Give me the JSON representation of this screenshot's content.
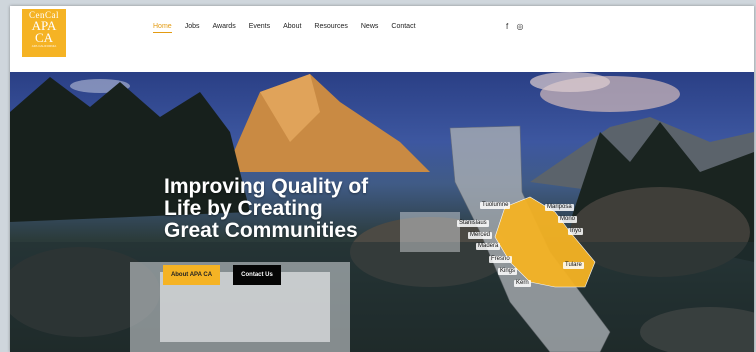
{
  "logo": {
    "line1": "CenCal",
    "line2": "APA",
    "line3": "CA",
    "tagline": "APA CALIFORNIA"
  },
  "nav": {
    "items": [
      "Home",
      "Jobs",
      "Awards",
      "Events",
      "About",
      "Resources",
      "News",
      "Contact"
    ],
    "active": "Home"
  },
  "social": {
    "facebook": "f",
    "instagram": "◎"
  },
  "hero": {
    "headline_lines": [
      "Improving Quality of",
      "Life by Creating",
      "Great Communities"
    ],
    "about_button": "About APA CA",
    "contact_button": "Contact Us"
  },
  "map": {
    "counties": [
      "Tuolumne",
      "Mariposa",
      "Stanislaus",
      "Mono",
      "Merced",
      "Inyo",
      "Madera",
      "Fresno",
      "Tulare",
      "Kings",
      "Kern"
    ]
  },
  "colors": {
    "accent": "#f5b324",
    "nav_active": "#e39b12"
  }
}
